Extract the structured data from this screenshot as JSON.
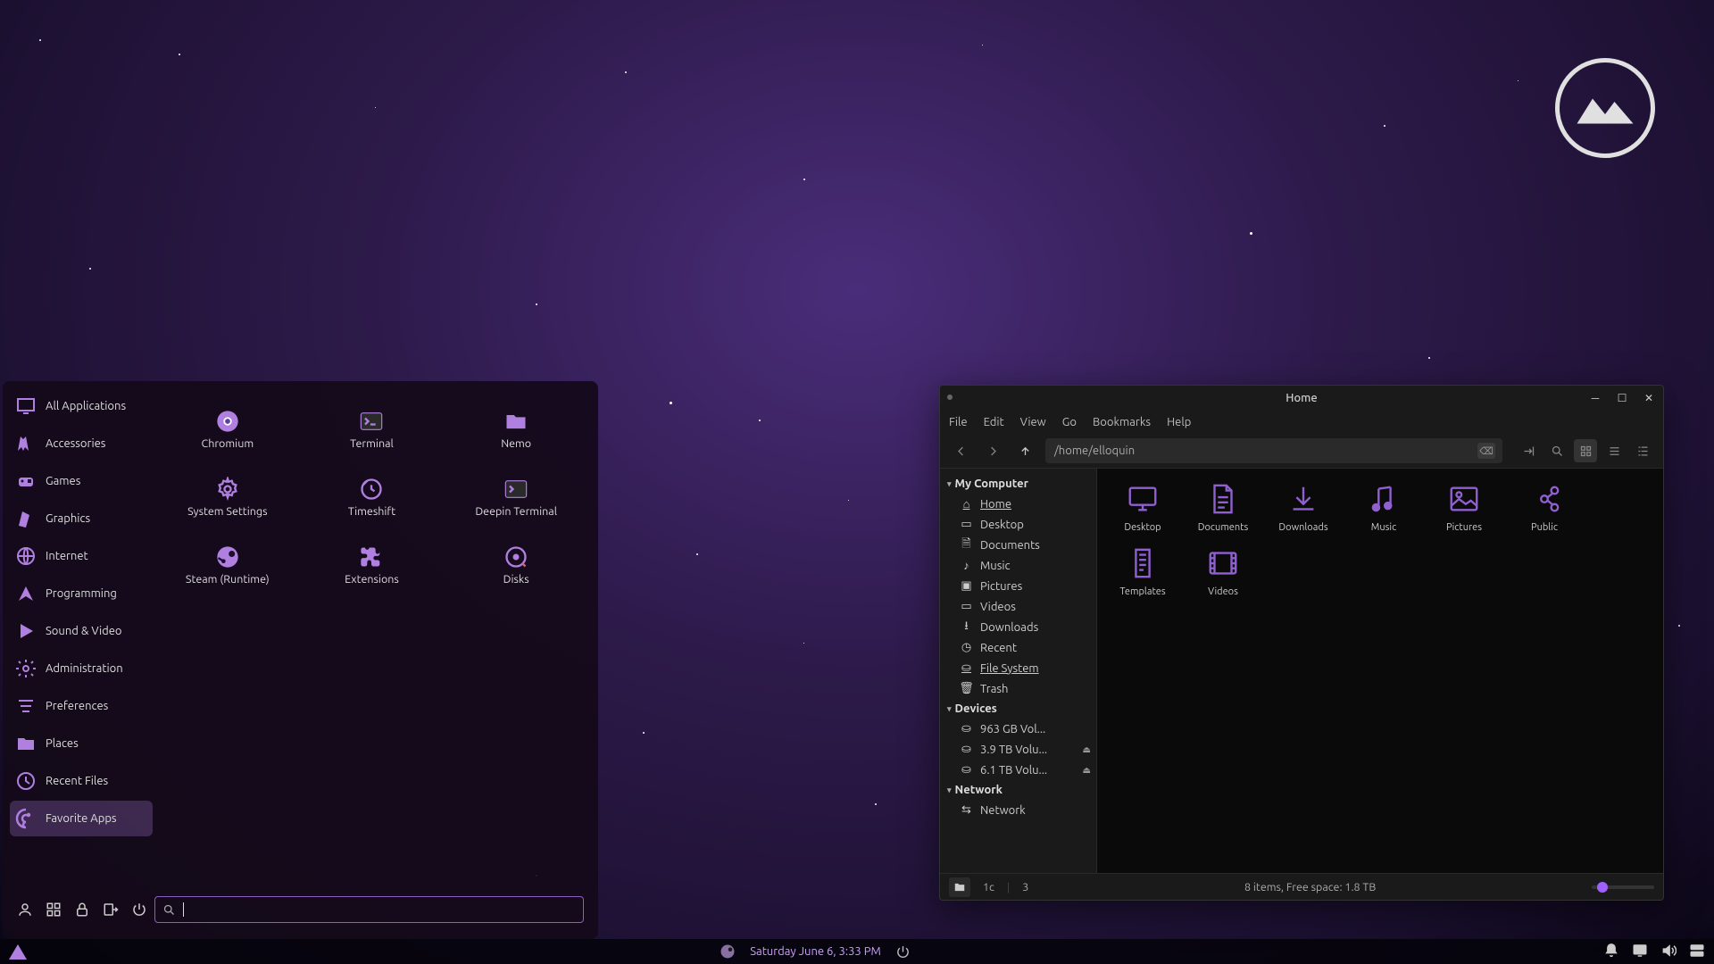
{
  "desktop": {
    "logo_alt": "distro-mountain-logo"
  },
  "start_menu": {
    "categories": [
      "All Applications",
      "Accessories",
      "Games",
      "Graphics",
      "Internet",
      "Programming",
      "Sound & Video",
      "Administration",
      "Preferences",
      "Places",
      "Recent Files",
      "Favorite Apps"
    ],
    "active_category_index": 11,
    "apps": [
      {
        "name": "Chromium",
        "icon": "chrome-icon"
      },
      {
        "name": "Terminal",
        "icon": "terminal-icon"
      },
      {
        "name": "Nemo",
        "icon": "folder-icon"
      },
      {
        "name": "System Settings",
        "icon": "gear-icon"
      },
      {
        "name": "Timeshift",
        "icon": "timeshift-icon"
      },
      {
        "name": "Deepin Terminal",
        "icon": "terminal-alt-icon"
      },
      {
        "name": "Steam (Runtime)",
        "icon": "steam-icon"
      },
      {
        "name": "Extensions",
        "icon": "puzzle-icon"
      },
      {
        "name": "Disks",
        "icon": "disks-icon"
      }
    ],
    "search_placeholder": ""
  },
  "file_manager": {
    "title": "Home",
    "menubar": [
      "File",
      "Edit",
      "View",
      "Go",
      "Bookmarks",
      "Help"
    ],
    "path": "/home/elloquin",
    "sidebar": {
      "sections": [
        {
          "header": "My Computer",
          "items": [
            {
              "label": "Home",
              "icon": "home-icon",
              "active": true
            },
            {
              "label": "Desktop",
              "icon": "desktop-mini-icon"
            },
            {
              "label": "Documents",
              "icon": "doc-mini-icon"
            },
            {
              "label": "Music",
              "icon": "music-mini-icon"
            },
            {
              "label": "Pictures",
              "icon": "pic-mini-icon"
            },
            {
              "label": "Videos",
              "icon": "video-mini-icon"
            },
            {
              "label": "Downloads",
              "icon": "download-mini-icon"
            },
            {
              "label": "Recent",
              "icon": "recent-icon"
            },
            {
              "label": "File System",
              "icon": "drive-icon",
              "underline": true
            },
            {
              "label": "Trash",
              "icon": "trash-icon"
            }
          ]
        },
        {
          "header": "Devices",
          "items": [
            {
              "label": "963 GB Vol...",
              "icon": "drive-icon",
              "trunc": true
            },
            {
              "label": "3.9 TB Volu...",
              "icon": "drive-icon",
              "eject": true,
              "trunc": true
            },
            {
              "label": "6.1 TB Volu...",
              "icon": "drive-icon",
              "eject": true,
              "trunc": true
            }
          ]
        },
        {
          "header": "Network",
          "items": [
            {
              "label": "Network",
              "icon": "network-icon"
            }
          ]
        }
      ]
    },
    "folders": [
      {
        "label": "Desktop",
        "icon": "desktop-big"
      },
      {
        "label": "Documents",
        "icon": "documents-big"
      },
      {
        "label": "Downloads",
        "icon": "downloads-big"
      },
      {
        "label": "Music",
        "icon": "music-big"
      },
      {
        "label": "Pictures",
        "icon": "pictures-big"
      },
      {
        "label": "Public",
        "icon": "public-big"
      },
      {
        "label": "Templates",
        "icon": "templates-big"
      },
      {
        "label": "Videos",
        "icon": "videos-big"
      }
    ],
    "status": "8 items, Free space: 1.8  TB",
    "status_left": [
      "1c",
      "3"
    ]
  },
  "taskbar": {
    "datetime": "Saturday June  6,  3:33 PM"
  },
  "colors": {
    "accent": "#b080e0",
    "bg_dark": "#1a1a1a"
  }
}
